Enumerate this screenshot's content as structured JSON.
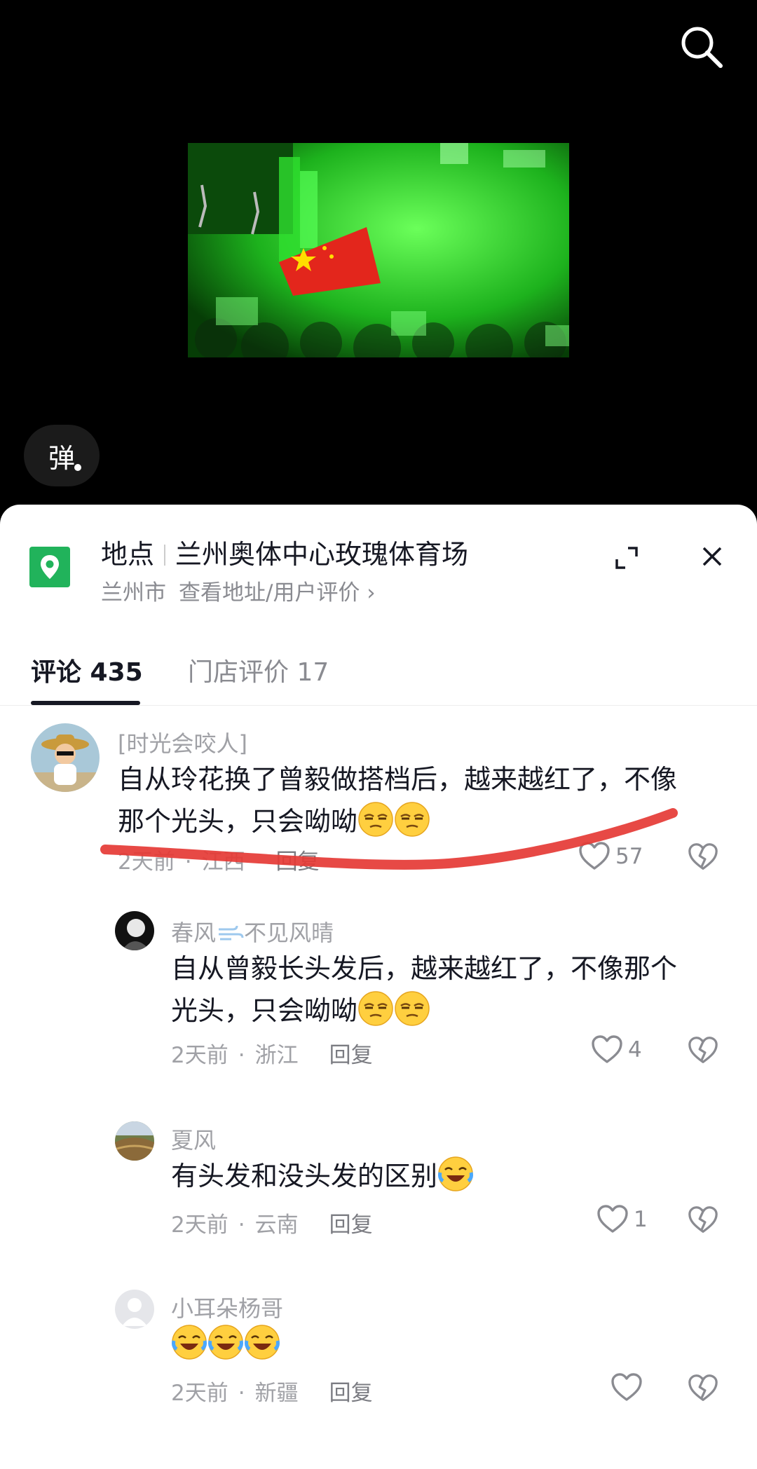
{
  "danmaku_label": "弹",
  "location": {
    "title_prefix": "地点",
    "title": "兰州奥体中心玫瑰体育场",
    "city": "兰州市",
    "address_link": "查看地址/用户评价 ›"
  },
  "tabs": [
    {
      "label": "评论 435"
    },
    {
      "label": "门店评价 17"
    }
  ],
  "comments": [
    {
      "user": "[时光会咬人]",
      "line1": "自从玲花换了曾毅做搭档后，越来越红了，不像",
      "line2": "那个光头，只会呦呦",
      "emoji": "smirk-emoji x2",
      "time": "2天前",
      "region": "江西",
      "reply": "回复",
      "likes": "57"
    },
    {
      "user_a": "春风",
      "user_b": "不见风晴",
      "line1": "自从曾毅长头发后，越来越红了，不像那个",
      "line2": "光头，只会呦呦",
      "emoji": "smirk-emoji x2",
      "time": "2天前",
      "region": "浙江",
      "reply": "回复",
      "likes": "4"
    },
    {
      "user": "夏风",
      "text": "有头发和没头发的区别",
      "emoji": "laugh-cry-emoji",
      "time": "2天前",
      "region": "云南",
      "reply": "回复",
      "likes": "1"
    },
    {
      "user": "小耳朵杨哥",
      "emoji": "laugh-cry-emoji x3",
      "time": "2天前",
      "region": "新疆",
      "reply": "回复",
      "likes": ""
    }
  ],
  "colors": {
    "accent_green": "#21b35b",
    "annotation_red": "#e53935",
    "text_primary": "#161823",
    "text_secondary": "#a0a1a6"
  }
}
